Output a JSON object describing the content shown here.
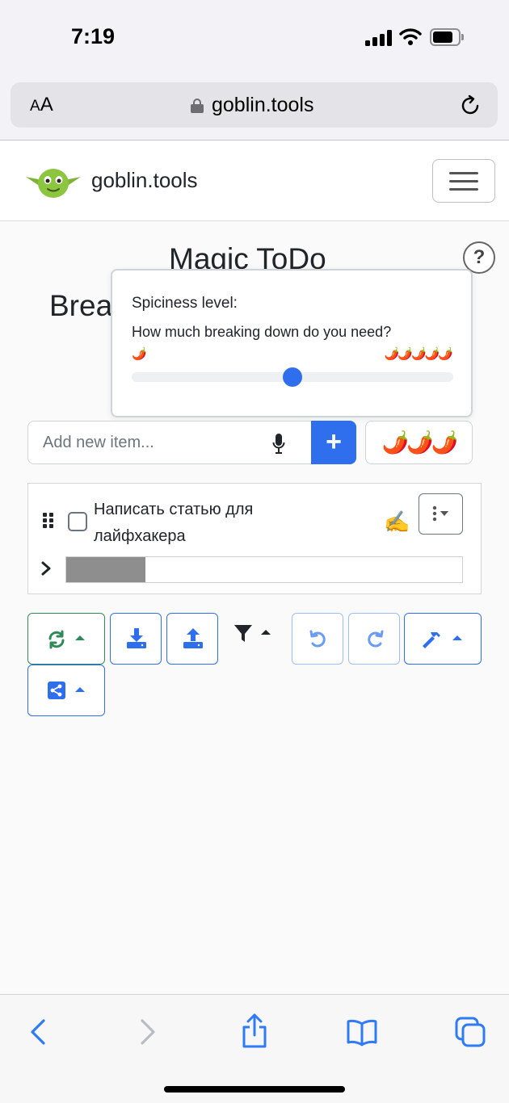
{
  "status": {
    "time": "7:19"
  },
  "browser": {
    "text_size_label_small": "A",
    "text_size_label_large": "A",
    "domain": "goblin.tools"
  },
  "navbar": {
    "brand": "goblin.tools"
  },
  "page": {
    "title": "Magic ToDo",
    "subtitle_visible": "Brea",
    "help_label": "?"
  },
  "popover": {
    "title": "Spiciness level:",
    "description": "How much breaking down do you need?",
    "min_label": "🌶️",
    "max_label": "🌶️🌶️🌶️🌶️🌶️",
    "level_fraction": 0.5
  },
  "add_item": {
    "placeholder": "Add new item...",
    "add_label": "+",
    "spiciness_label": "🌶️🌶️🌶️"
  },
  "tasks": [
    {
      "text": "Написать статью для лайфхакера",
      "emoji": "✍️",
      "progress_fraction": 0.2
    }
  ],
  "colors": {
    "accent": "#2f6fed",
    "success": "#2e8b57",
    "progress_gray": "#8e8e8e"
  },
  "icons": [
    "sync-icon",
    "download-icon",
    "upload-icon",
    "filter-icon",
    "undo-icon",
    "redo-icon",
    "hammer-icon",
    "share-icon"
  ]
}
